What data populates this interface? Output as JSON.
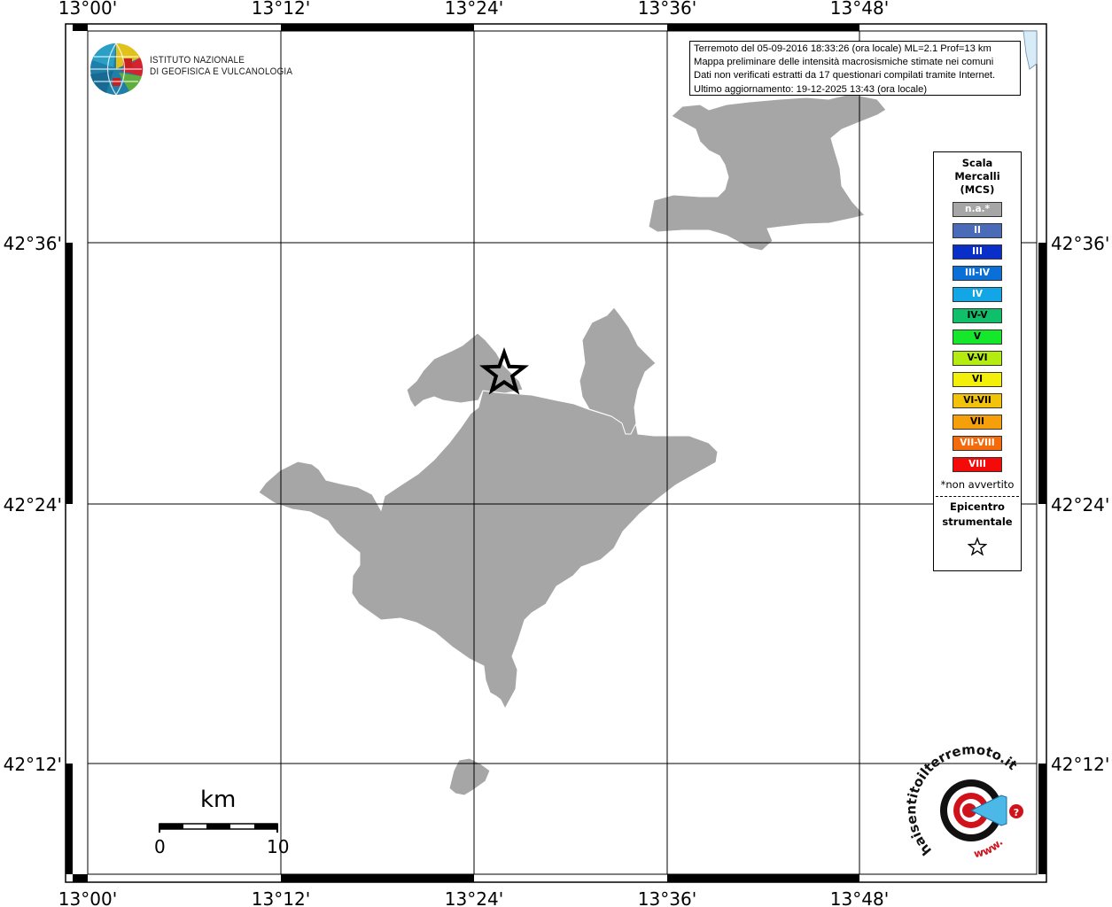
{
  "map": {
    "lon_labels": [
      "13°00'",
      "13°12'",
      "13°24'",
      "13°36'",
      "13°48'"
    ],
    "lat_labels": [
      "42°36'",
      "42°24'",
      "42°12'"
    ],
    "area_fill": "#a6a6a6",
    "area_stroke": "#ffffff"
  },
  "institute": {
    "line1": "ISTITUTO NAZIONALE",
    "line2": "DI GEOFISICA E VULCANOLOGIA"
  },
  "info": {
    "line1": "Terremoto del 05-09-2016 18:33:26 (ora locale) ML=2.1 Prof=13 km",
    "line2": "Mappa preliminare delle intensità macrosismiche stimate nei comuni",
    "line3": "Dati non verificati estratti da 17 questionari compilati tramite Internet.",
    "line4": "Ultimo aggiornamento: 19-12-2025 13:43 (ora locale)"
  },
  "legend": {
    "title1": "Scala",
    "title2": "Mercalli",
    "title3": "(MCS)",
    "items": [
      {
        "label": "n.a.*",
        "color": "#a6a6a6"
      },
      {
        "label": "II",
        "color": "#4a6bb8"
      },
      {
        "label": "III",
        "color": "#0a2fc9"
      },
      {
        "label": "III-IV",
        "color": "#0a6fd6"
      },
      {
        "label": "IV",
        "color": "#12a6e6"
      },
      {
        "label": "IV-V",
        "color": "#0fbf6a"
      },
      {
        "label": "V",
        "color": "#15e82a"
      },
      {
        "label": "V-VI",
        "color": "#b5ec10"
      },
      {
        "label": "VI",
        "color": "#f3ee0a"
      },
      {
        "label": "VI-VII",
        "color": "#f3c20a"
      },
      {
        "label": "VII",
        "color": "#f5a00a"
      },
      {
        "label": "VII-VIII",
        "color": "#f56a0a"
      },
      {
        "label": "VIII",
        "color": "#f50a0a"
      }
    ],
    "note": "*non avvertito",
    "epi1": "Epicentro",
    "epi2": "strumentale"
  },
  "scale": {
    "unit": "km",
    "min": "0",
    "max": "10"
  },
  "logo": {
    "text": "haisentitoilterremoto.it",
    "www": "www.",
    "accent": "#d0121b"
  }
}
